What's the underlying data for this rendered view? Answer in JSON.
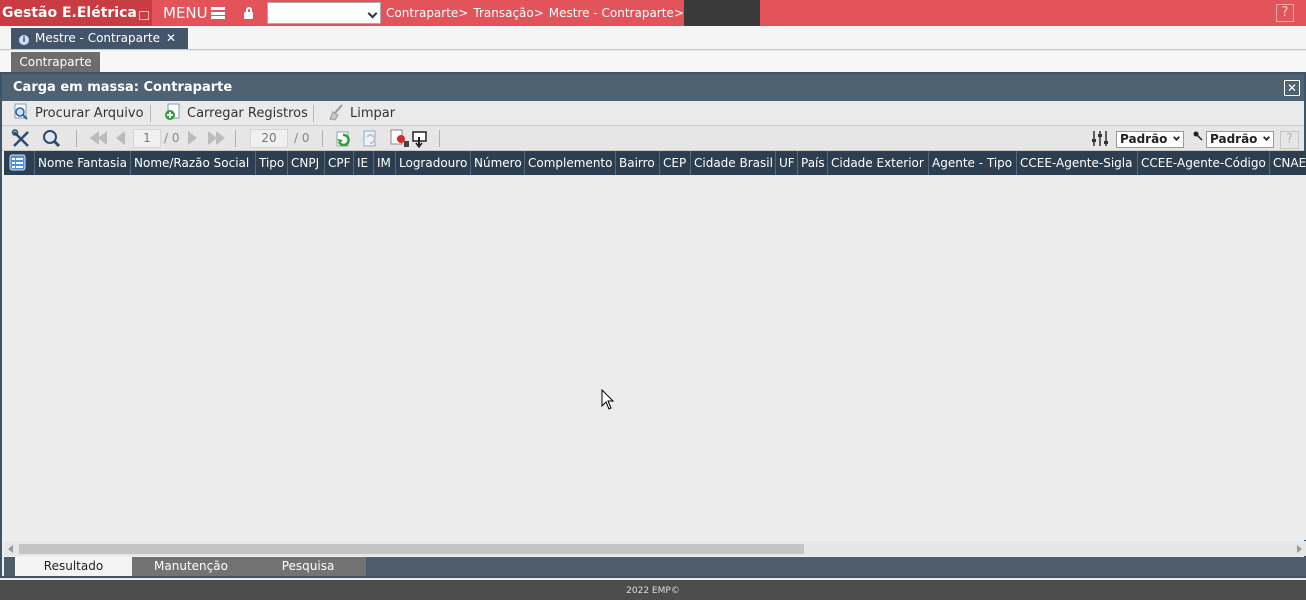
{
  "topbar": {
    "brand": "Gestão E.Elétrica",
    "menu_label": "MENU",
    "breadcrumbs": [
      "Contraparte>",
      "Transação>",
      "Mestre - Contraparte>"
    ],
    "help": "?"
  },
  "tabs": {
    "open_tab_label": "Mestre - Contraparte",
    "open_tab_close": "✕",
    "subtab_label": "Contraparte"
  },
  "window": {
    "title": "Carga em massa: Contraparte",
    "close": "✕"
  },
  "toolbar": {
    "browse_label": "Procurar Arquivo",
    "load_label": "Carregar Registros",
    "clear_label": "Limpar"
  },
  "pager": {
    "page": "1",
    "page_of": "/ 0",
    "page_size": "20",
    "size_of": "/ 0"
  },
  "view_selects": {
    "layout": "Padrão",
    "filter": "Padrão",
    "help": "?"
  },
  "grid": {
    "columns": [
      "Nome Fantasia",
      "Nome/Razão Social",
      "Tipo",
      "CNPJ",
      "CPF",
      "IE",
      "IM",
      "Logradouro",
      "Número",
      "Complemento",
      "Bairro",
      "CEP",
      "Cidade Brasil",
      "UF",
      "País",
      "Cidade Exterior",
      "Agente - Tipo",
      "CCEE-Agente-Sigla",
      "CCEE-Agente-Código",
      "CNAE"
    ]
  },
  "bottom_tabs": [
    "Resultado",
    "Manutenção",
    "Pesquisa"
  ],
  "footer": "2022 EMP©"
}
